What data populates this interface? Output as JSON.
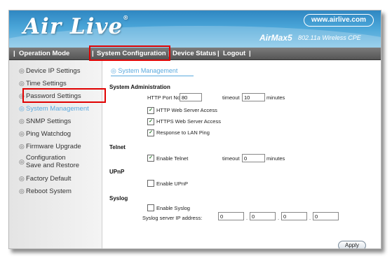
{
  "header": {
    "logo": "Air Live",
    "logo_reg": "®",
    "url_badge": "www.airlive.com",
    "model": "AirMax5",
    "model_desc": "802.11a Wireless CPE"
  },
  "nav": {
    "sep0": "|",
    "operation_mode": "Operation Mode",
    "sep1": "|",
    "system_configuration": "System Configuration",
    "sep2": "|",
    "device_status": "Device Status",
    "sep3": "|",
    "logout": "Logout",
    "sep4": "|"
  },
  "sidebar": {
    "bullet": "◎",
    "items": [
      {
        "label": "Device IP Settings"
      },
      {
        "label": "Time Settings"
      },
      {
        "label": "Password Settings"
      },
      {
        "label": "System Management"
      },
      {
        "label": "SNMP Settings"
      },
      {
        "label": "Ping Watchdog"
      },
      {
        "label": "Firmware Upgrade"
      },
      {
        "label": "Configuration",
        "label2": "Save and Restore"
      },
      {
        "label": "Factory Default"
      },
      {
        "label": "Reboot System"
      }
    ]
  },
  "page": {
    "title": "System Management",
    "admin": {
      "heading": "System Administration",
      "http_port_label": "HTTP Port No.",
      "http_port_value": "80",
      "timeout_label": "timeout",
      "timeout_value": "10",
      "minutes": "minutes",
      "http_access": "HTTP Web Server Access",
      "https_access": "HTTPS Web Server Access",
      "lan_ping": "Response to LAN Ping"
    },
    "telnet": {
      "heading": "Telnet",
      "enable": "Enable Telnet",
      "timeout_label": "timeout",
      "timeout_value": "0",
      "minutes": "minutes"
    },
    "upnp": {
      "heading": "UPnP",
      "enable": "Enable UPnP"
    },
    "syslog": {
      "heading": "Syslog",
      "enable": "Enable Syslog",
      "ip_label": "Syslog server IP address:",
      "ip": [
        "0",
        "0",
        "0",
        "0"
      ],
      "dot": "."
    },
    "apply": "Apply"
  }
}
